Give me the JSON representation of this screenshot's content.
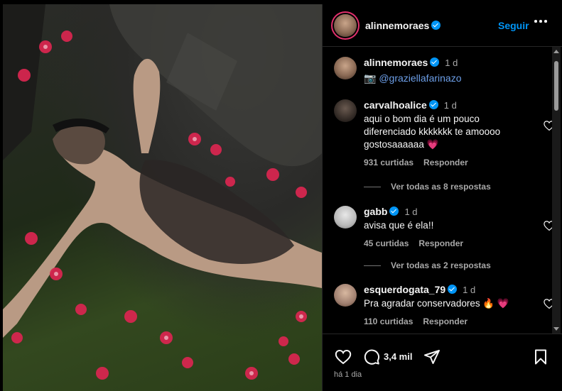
{
  "post": {
    "author": "alinnemoraes",
    "follow_label": "Seguir",
    "caption_time": "1 d",
    "caption_mention": "@graziellafarinazo",
    "posted_ago": "há 1 dia"
  },
  "comments": [
    {
      "user": "carvalhoalice",
      "verified": true,
      "time": "1 d",
      "text": "aqui o bom dia é um pouco diferenciado kkkkkkk te amoooo gostosaaaaaa 💗",
      "likes": "931 curtidas",
      "reply_label": "Responder",
      "view_replies": "Ver todas as 8 respostas"
    },
    {
      "user": "gabb",
      "verified": true,
      "time": "1 d",
      "text": "avisa que é ela!!",
      "likes": "45 curtidas",
      "reply_label": "Responder",
      "view_replies": "Ver todas as 2 respostas"
    },
    {
      "user": "esquerdogata_79",
      "verified": true,
      "time": "1 d",
      "text": "Pra agradar conservadores 🔥 💗",
      "likes": "110 curtidas",
      "reply_label": "Responder"
    }
  ],
  "actions": {
    "comment_count": "3,4 mil"
  },
  "colors": {
    "accent": "#0095f6",
    "story_ring": "#e1306c",
    "background": "#000000",
    "muted": "#a8a8a8"
  }
}
